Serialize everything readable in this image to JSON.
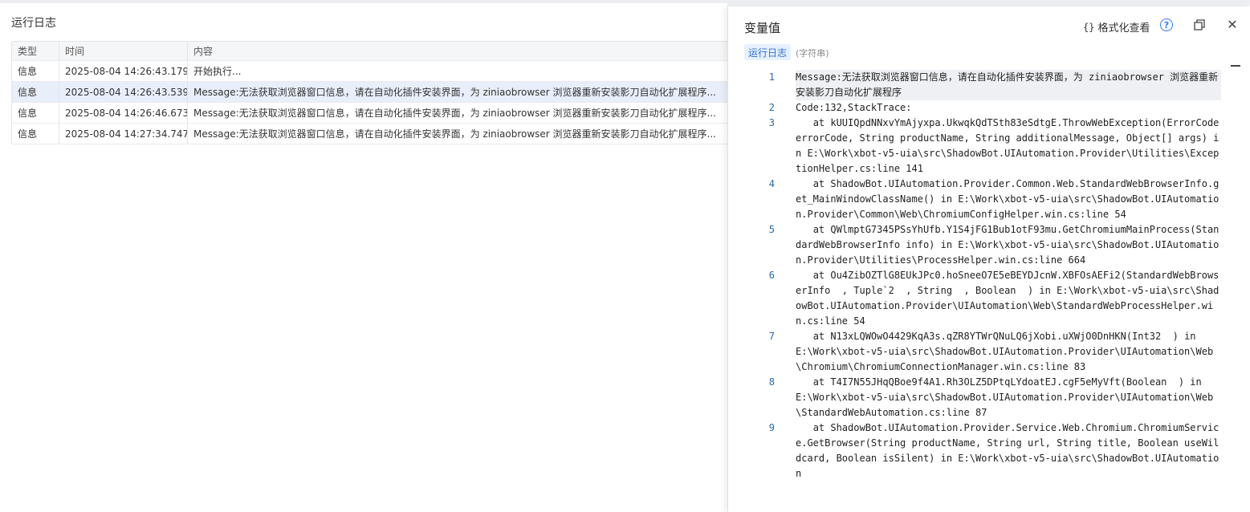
{
  "log_panel": {
    "title": "运行日志",
    "columns": [
      "类型",
      "时间",
      "内容"
    ],
    "rows": [
      {
        "type": "信息",
        "time": "2025-08-04 14:26:43.179",
        "content": "开始执行..."
      },
      {
        "type": "信息",
        "time": "2025-08-04 14:26:43.539",
        "content": "Message:无法获取浏览器窗口信息，请在自动化插件安装界面，为 ziniaobrowser 浏览器重新安装影刀自动化扩展程序..."
      },
      {
        "type": "信息",
        "time": "2025-08-04 14:26:46.673",
        "content": "Message:无法获取浏览器窗口信息，请在自动化插件安装界面，为 ziniaobrowser 浏览器重新安装影刀自动化扩展程序..."
      },
      {
        "type": "信息",
        "time": "2025-08-04 14:27:34.747",
        "content": "Message:无法获取浏览器窗口信息，请在自动化插件安装界面，为 ziniaobrowser 浏览器重新安装影刀自动化扩展程序..."
      }
    ]
  },
  "var_panel": {
    "title": "变量值",
    "format_label": "格式化查看",
    "format_icon_text": "{}",
    "help_icon_text": "?",
    "close_icon_text": "✕",
    "var_name": "运行日志",
    "var_type": "(字符串)",
    "lines": [
      {
        "n": "1",
        "text": "Message:无法获取浏览器窗口信息，请在自动化插件安装界面，为 ziniaobrowser 浏览器重新安装影刀自动化扩展程序"
      },
      {
        "n": "2",
        "text": "Code:132,StackTrace:"
      },
      {
        "n": "3",
        "text": "   at kUUIQpdNNxvYmAjyxpa.UkwqkQdTSth83eSdtgE.ThrowWebException(ErrorCode errorCode, String productName, String additionalMessage, Object[] args) in E:\\Work\\xbot-v5-uia\\src\\ShadowBot.UIAutomation.Provider\\Utilities\\ExceptionHelper.cs:line 141"
      },
      {
        "n": "4",
        "text": "   at ShadowBot.UIAutomation.Provider.Common.Web.StandardWebBrowserInfo.get_MainWindowClassName() in E:\\Work\\xbot-v5-uia\\src\\ShadowBot.UIAutomation.Provider\\Common\\Web\\ChromiumConfigHelper.win.cs:line 54"
      },
      {
        "n": "5",
        "text": "   at QWlmptG7345PSsYhUfb.Y1S4jFG1Bub1otF93mu.GetChromiumMainProcess(StandardWebBrowserInfo info) in E:\\Work\\xbot-v5-uia\\src\\ShadowBot.UIAutomation.Provider\\Utilities\\ProcessHelper.win.cs:line 664"
      },
      {
        "n": "6",
        "text": "   at Ou4ZibOZTlG8EUkJPc0.hoSneeO7E5eBEYDJcnW.XBFOsAEFi2(StandardWebBrowserInfo  , Tuple`2  , String  , Boolean  ) in E:\\Work\\xbot-v5-uia\\src\\ShadowBot.UIAutomation.Provider\\UIAutomation\\Web\\StandardWebProcessHelper.win.cs:line 54"
      },
      {
        "n": "7",
        "text": "   at N13xLQWOwO4429KqA3s.qZR8YTWrQNuLQ6jXobi.uXWjO0DnHKN(Int32  ) in E:\\Work\\xbot-v5-uia\\src\\ShadowBot.UIAutomation.Provider\\UIAutomation\\Web\\Chromium\\ChromiumConnectionManager.win.cs:line 83"
      },
      {
        "n": "8",
        "text": "   at T4I7N55JHqQBoe9f4A1.Rh3OLZ5DPtqLYdoatEJ.cgF5eMyVft(Boolean  ) in E:\\Work\\xbot-v5-uia\\src\\ShadowBot.UIAutomation.Provider\\UIAutomation\\Web\\StandardWebAutomation.cs:line 87"
      },
      {
        "n": "9",
        "text": "   at ShadowBot.UIAutomation.Provider.Service.Web.Chromium.ChromiumService.GetBrowser(String productName, String url, String title, Boolean useWildcard, Boolean isSilent) in E:\\Work\\xbot-v5-uia\\src\\ShadowBot.UIAutomation"
      }
    ]
  }
}
